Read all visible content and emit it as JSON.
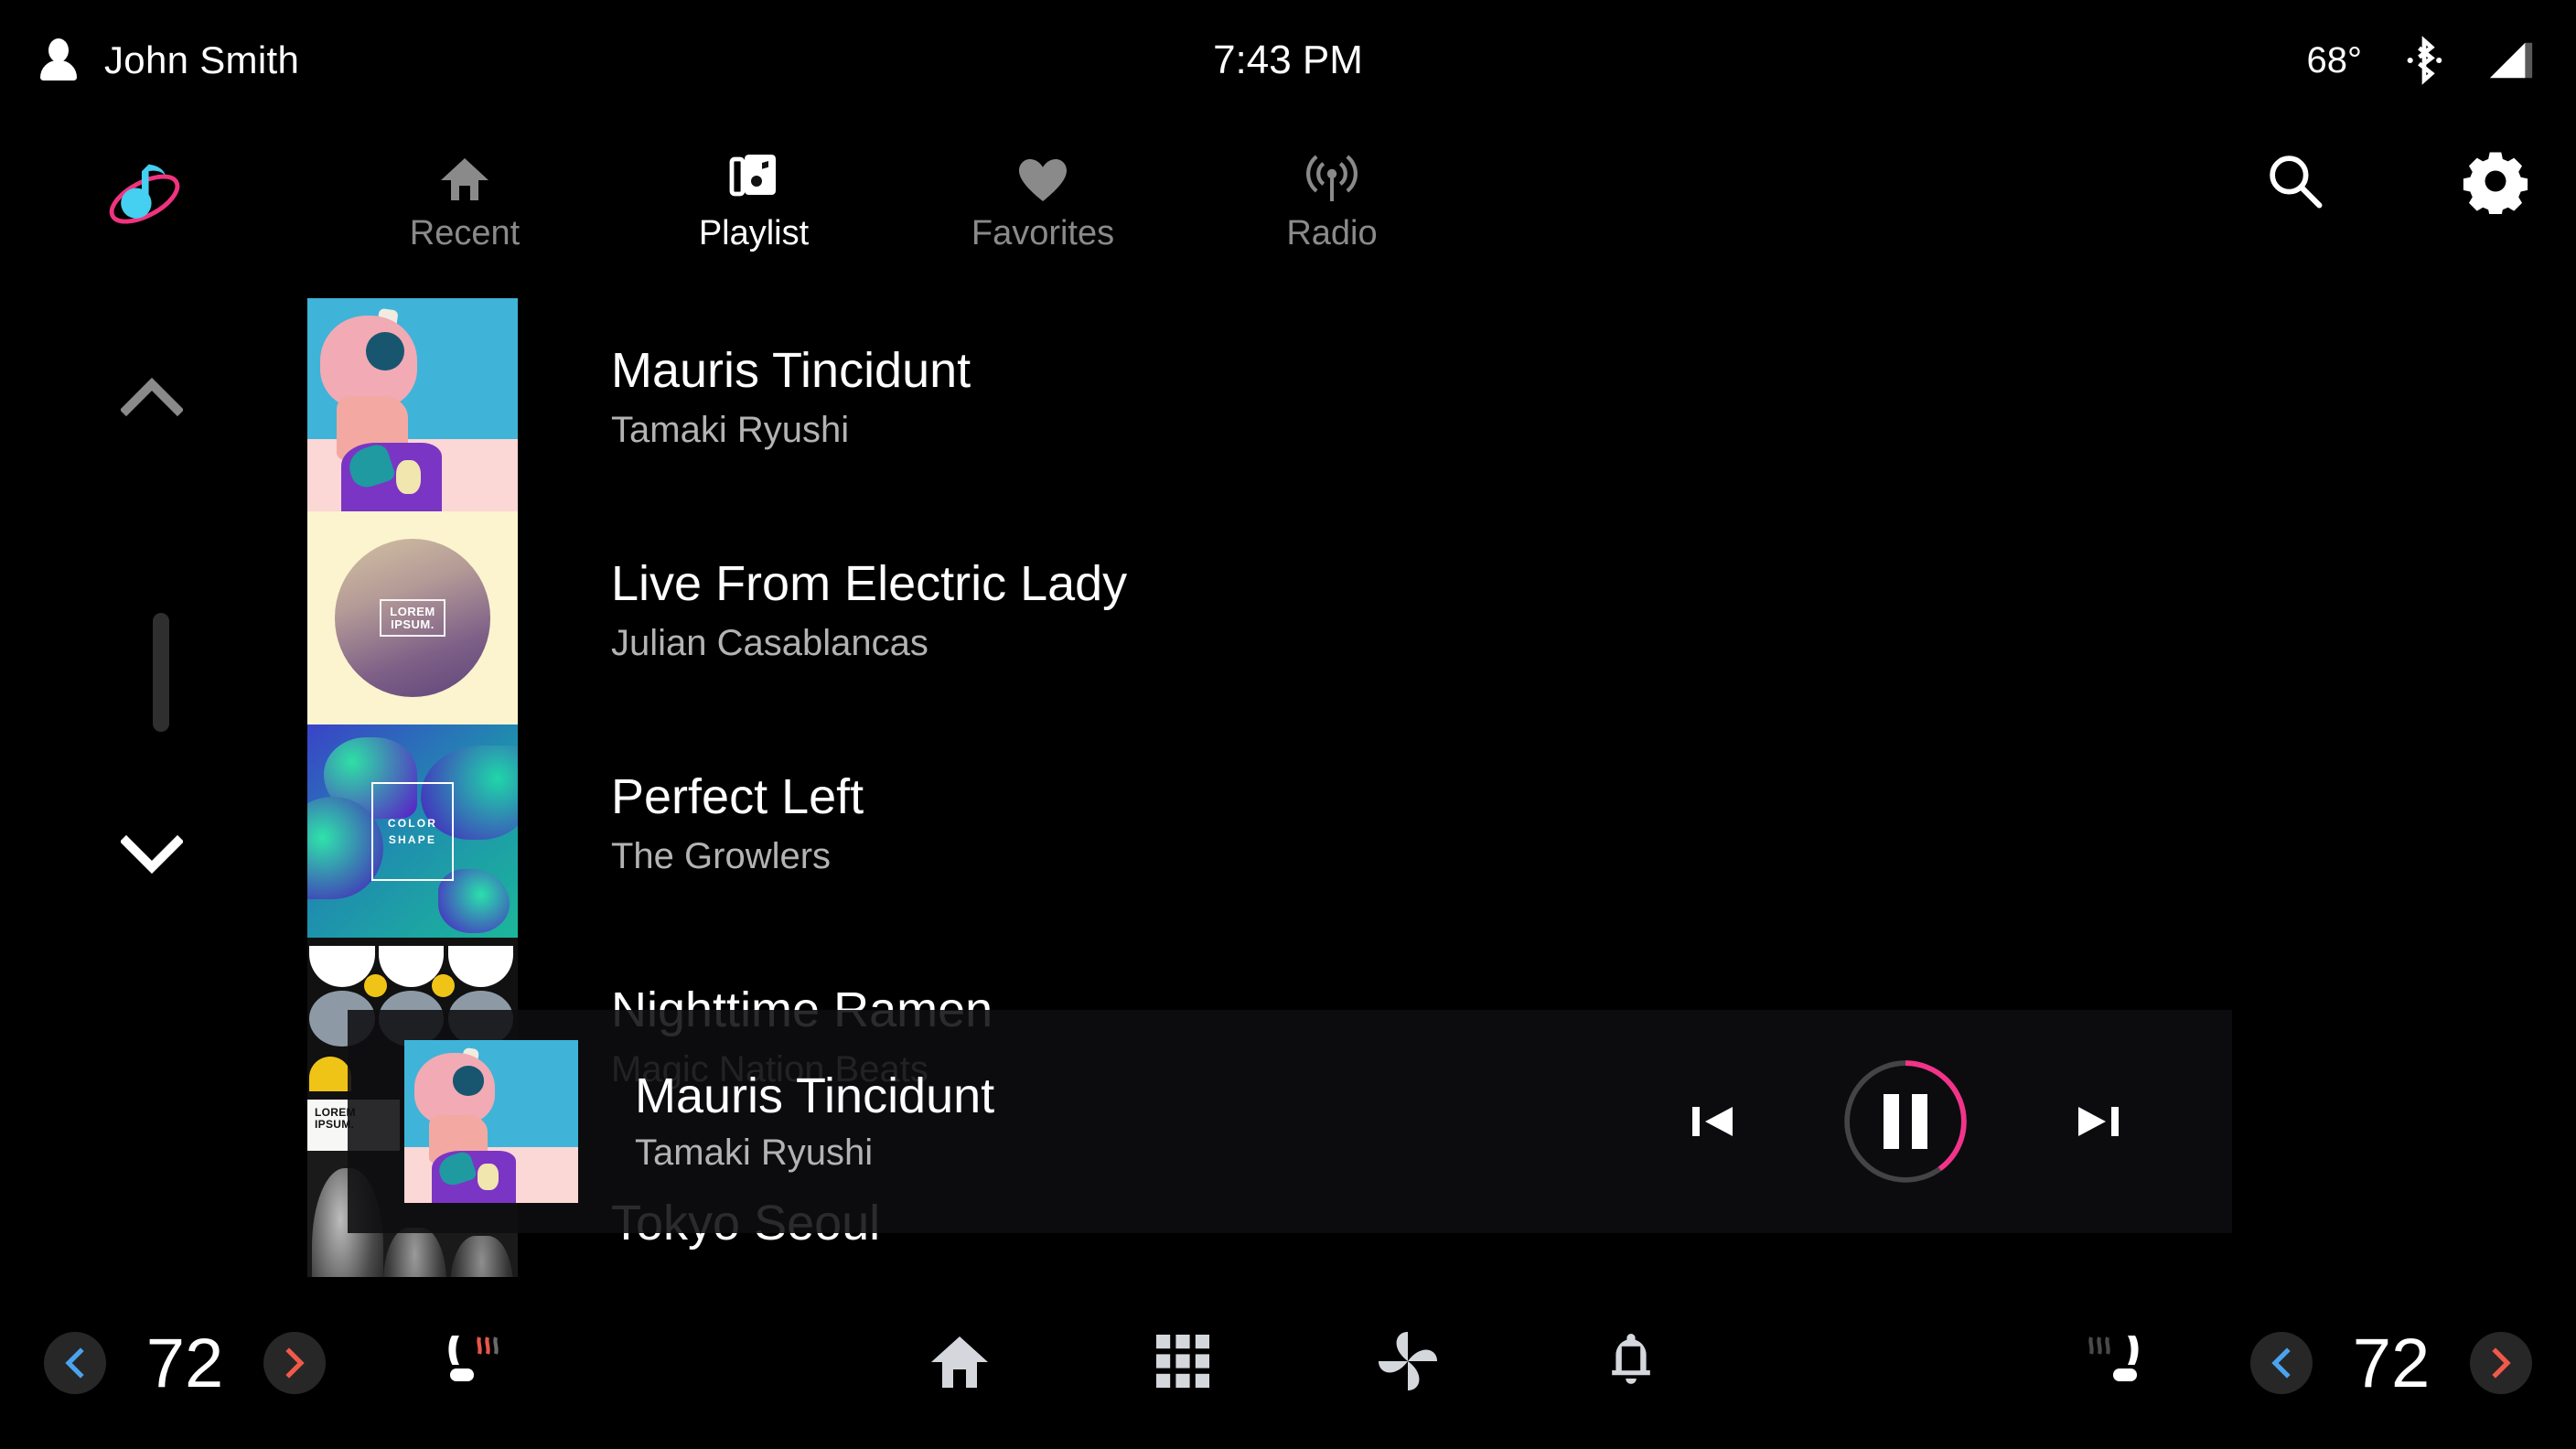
{
  "status_bar": {
    "user_icon": "person-icon",
    "user_name": "John Smith",
    "clock": "7:43 PM",
    "temperature": "68°",
    "bluetooth_icon": "bluetooth-icon",
    "signal_icon": "signal-bars-icon"
  },
  "app": {
    "logo_icon": "music-note-orbit-logo",
    "tabs": [
      {
        "label": "Recent",
        "icon": "home-icon",
        "active": false
      },
      {
        "label": "Playlist",
        "icon": "playlist-icon",
        "active": true
      },
      {
        "label": "Favorites",
        "icon": "heart-icon",
        "active": false
      },
      {
        "label": "Radio",
        "icon": "broadcast-icon",
        "active": false
      }
    ],
    "search_icon": "search-icon",
    "settings_icon": "gear-icon"
  },
  "scroll": {
    "up_icon": "chevron-up-icon",
    "down_icon": "chevron-down-icon"
  },
  "tracks": [
    {
      "title": "Mauris Tincidunt",
      "artist": "Tamaki Ryushi",
      "art": "girl"
    },
    {
      "title": "Live From Electric Lady",
      "artist": "Julian Casablancas",
      "art": "sphere"
    },
    {
      "title": "Perfect Left",
      "artist": "The Growlers",
      "art": "shape"
    },
    {
      "title": "Nighttime Ramen",
      "artist": "Magic Nation Beats",
      "art": "geo"
    },
    {
      "title": "Tokyo Seoul",
      "artist": "",
      "art": "bw"
    }
  ],
  "now_playing": {
    "title": "Mauris Tincidunt",
    "artist": "Tamaki Ryushi",
    "art": "girl",
    "prev_icon": "skip-previous-icon",
    "play_state_icon": "pause-icon",
    "next_icon": "skip-next-icon",
    "progress_percent": 40,
    "progress_color": "#f3338a",
    "track_color": "#444444"
  },
  "climate": {
    "driver": {
      "decrease_icon": "chevron-left-icon",
      "temp": "72",
      "increase_icon": "chevron-right-icon",
      "seat_heater_icon": "heated-seat-icon"
    },
    "passenger": {
      "decrease_icon": "chevron-left-icon",
      "temp": "72",
      "increase_icon": "chevron-right-icon",
      "seat_heater_icon": "heated-seat-icon"
    },
    "cool_color": "#4aa3ef",
    "warm_color": "#ef5a4a",
    "heat_line_color": "#e8564a"
  },
  "nav_bar": [
    {
      "icon": "home-icon"
    },
    {
      "icon": "apps-grid-icon"
    },
    {
      "icon": "fan-climate-icon"
    },
    {
      "icon": "bell-notifications-icon"
    }
  ]
}
